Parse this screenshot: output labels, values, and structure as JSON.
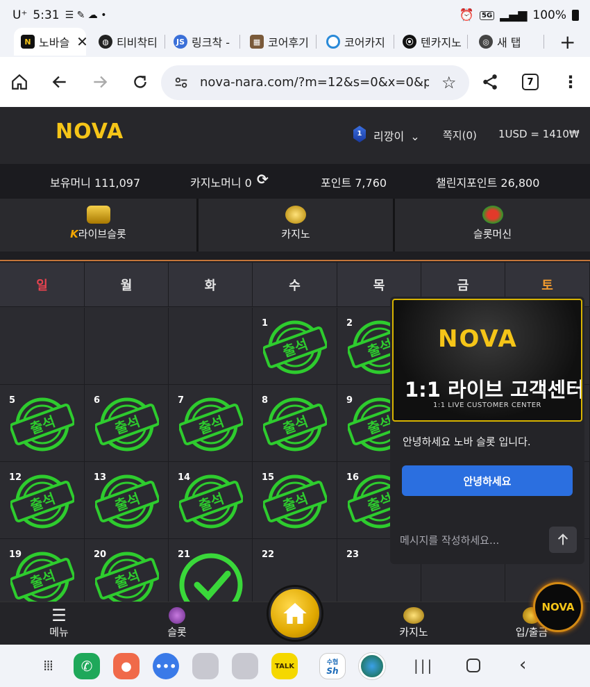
{
  "status_bar": {
    "carrier": "U⁺",
    "time": "5:31",
    "network": "5G",
    "battery": "100%"
  },
  "tabs": [
    {
      "label": "노바슬",
      "active": true
    },
    {
      "label": "티비착티"
    },
    {
      "label": "링크착 -"
    },
    {
      "label": "코어후기"
    },
    {
      "label": "코어카지"
    },
    {
      "label": "텐카지노"
    },
    {
      "label": "새 탭"
    }
  ],
  "address_bar": {
    "url": "nova-nara.com/?m=12&s=0&x=0&p=",
    "tab_count": "7"
  },
  "header": {
    "logo": "NOVA",
    "user_level": "1",
    "username": "리깡이",
    "messages": "쪽지(0)",
    "exchange_rate": "1USD = 1410₩"
  },
  "balances": {
    "money": "보유머니 111,097",
    "casino_money": "카지노머니 0",
    "points": "포인트 7,760",
    "challenge_points": "챌린지포인트 26,800"
  },
  "categories": [
    {
      "label": "라이브슬롯",
      "icon": "slot-machine-icon"
    },
    {
      "label": "카지노",
      "icon": "crown-icon"
    },
    {
      "label": "슬롯머신",
      "icon": "slot-coin-icon"
    }
  ],
  "calendar": {
    "weekdays": [
      "일",
      "월",
      "화",
      "수",
      "목",
      "금",
      "토"
    ],
    "stamp_text": "출석",
    "weekday_colors": {
      "sunday": "#e8434f",
      "saturday": "#f39c2f"
    }
  },
  "chat": {
    "banner_logo": "NOVA",
    "banner_title": "1:1 라이브 고객센터",
    "banner_subtitle": "1:1 LIVE CUSTOMER CENTER",
    "greeting": "안녕하세요 노바 슬롯 입니다.",
    "button_label": "안녕하세요",
    "input_placeholder": "메시지를 작성하세요..."
  },
  "bottom_nav": {
    "menu": "메뉴",
    "slot": "슬롯",
    "casino": "카지노",
    "deposit": "입/출금",
    "float_logo": "NOVA"
  },
  "sys_apps": {
    "kakao": "TALK",
    "bank_top": "수협",
    "bank": "Sh"
  }
}
